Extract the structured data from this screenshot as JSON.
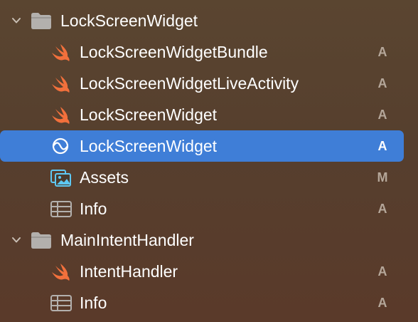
{
  "navigator": {
    "groups": [
      {
        "name": "LockScreenWidget",
        "icon": "folder-icon",
        "expanded": true,
        "files": [
          {
            "name": "LockScreenWidgetBundle",
            "icon": "swift-icon",
            "status": "A"
          },
          {
            "name": "LockScreenWidgetLiveActivity",
            "icon": "swift-icon",
            "status": "A"
          },
          {
            "name": "LockScreenWidget",
            "icon": "swift-icon",
            "status": "A"
          },
          {
            "name": "LockScreenWidget",
            "icon": "intent-definition-icon",
            "status": "A",
            "selected": true
          },
          {
            "name": "Assets",
            "icon": "asset-catalog-icon",
            "status": "M"
          },
          {
            "name": "Info",
            "icon": "plist-table-icon",
            "status": "A"
          }
        ]
      },
      {
        "name": "MainIntentHandler",
        "icon": "folder-icon",
        "expanded": true,
        "files": [
          {
            "name": "IntentHandler",
            "icon": "swift-icon",
            "status": "A"
          },
          {
            "name": "Info",
            "icon": "plist-table-icon",
            "status": "A"
          }
        ]
      }
    ]
  },
  "colors": {
    "selection": "#3f7ed7",
    "swift_orange": "#f2703c",
    "folder_gray": "#b3b0ad",
    "status_text": "#b5a79a",
    "intent_cyan": "#5ec8f2"
  }
}
